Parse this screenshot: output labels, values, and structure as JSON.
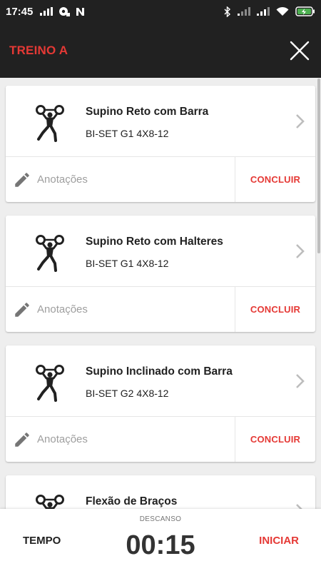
{
  "status_bar": {
    "time": "17:45",
    "left_icons": [
      "signal-bars-icon",
      "hotspot-icon",
      "notification-n-icon"
    ],
    "right_icons": [
      "bluetooth-icon",
      "cell-signal-icon",
      "cell-signal-icon",
      "wifi-icon",
      "battery-charging-icon"
    ]
  },
  "app_bar": {
    "title": "TREINO A",
    "close_icon": "close-icon"
  },
  "exercises": [
    {
      "name": "Supino Reto com Barra",
      "detail": "BI-SET G1 4X8-12",
      "notes_placeholder": "Anotações",
      "action": "CONCLUIR"
    },
    {
      "name": "Supino Reto com Halteres",
      "detail": "BI-SET G1 4X8-12",
      "notes_placeholder": "Anotações",
      "action": "CONCLUIR"
    },
    {
      "name": "Supino Inclinado com Barra",
      "detail": "BI-SET G2 4X8-12",
      "notes_placeholder": "Anotações",
      "action": "CONCLUIR"
    },
    {
      "name": "Flexão de Braços",
      "detail": "",
      "notes_placeholder": "",
      "action": ""
    }
  ],
  "bottom_bar": {
    "left_label": "TEMPO",
    "rest_label": "DESCANSO",
    "timer": "00:15",
    "right_label": "INICIAR"
  },
  "colors": {
    "accent": "#e53935",
    "appbar_bg": "#212121",
    "background": "#eeeeee"
  }
}
